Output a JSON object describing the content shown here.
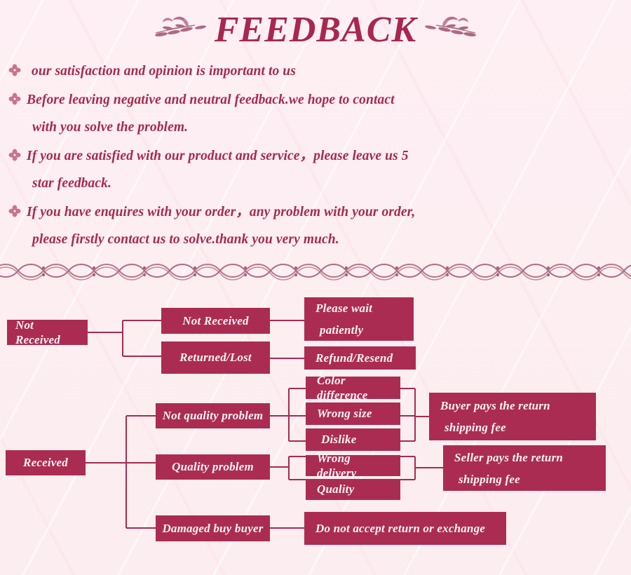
{
  "header": {
    "title": "FEEDBACK",
    "ornament_left": "floral-branch-ornament",
    "ornament_right": "floral-branch-ornament"
  },
  "colors": {
    "background": "#fdeff2",
    "accent": "#a62a50",
    "node_fill": "#ab2c52",
    "node_text": "#fdf3f5",
    "line": "#a82a51",
    "bullet": "#c9738f"
  },
  "bullets": [
    {
      "icon": "flower-bullet-icon",
      "lines": [
        "our satisfaction and opinion is important to us"
      ]
    },
    {
      "icon": "flower-bullet-icon",
      "lines": [
        "Before leaving negative and neutral feedback.we hope to contact",
        "with you solve the problem."
      ]
    },
    {
      "icon": "flower-bullet-icon",
      "lines": [
        "If you are satisfied with our product and service，please leave us 5",
        "star feedback."
      ]
    },
    {
      "icon": "flower-bullet-icon",
      "lines": [
        "If you have enquires with your order，any problem with your order,",
        "please firstly contact us to solve.thank you very much."
      ]
    }
  ],
  "divider": {
    "style": "braided-ribbon-divider"
  },
  "flowchart": {
    "nodes": {
      "not_received_root": "Not Received",
      "not_received_branch": "Not Received",
      "returned_lost": "Returned/Lost",
      "please_wait_l1": "Please wait",
      "please_wait_l2": "patiently",
      "refund_resend": "Refund/Resend",
      "received_root": "Received",
      "not_quality_problem": "Not quality problem",
      "color_difference": "Color difference",
      "wrong_size": "Wrong size",
      "dislike": "Dislike",
      "buyer_pays_l1": "Buyer pays the return",
      "buyer_pays_l2": "shipping fee",
      "quality_problem": "Quality problem",
      "wrong_delivery": "Wrong delivery",
      "quality": "Quality",
      "seller_pays_l1": "Seller pays the return",
      "seller_pays_l2": "shipping fee",
      "damaged_by_buyer": "Damaged buy buyer",
      "no_return_exchange": "Do not accept return or exchange"
    }
  }
}
